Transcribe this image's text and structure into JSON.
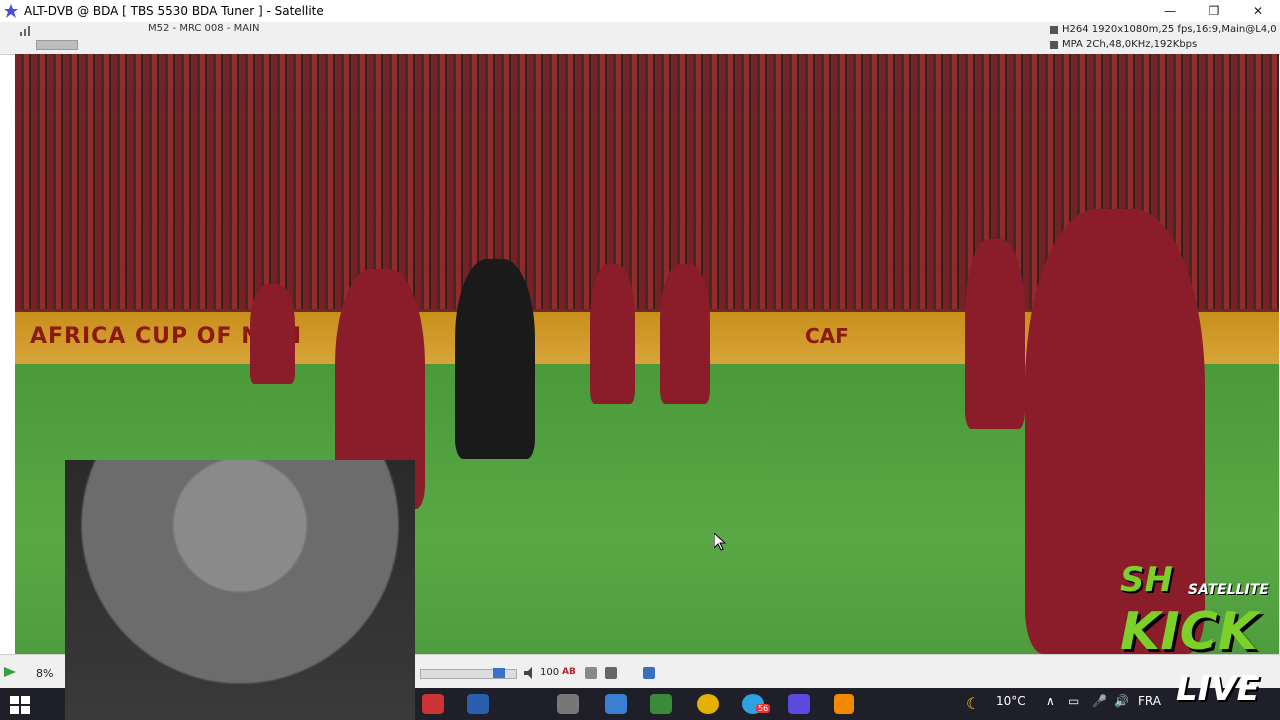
{
  "window": {
    "title": "ALT-DVB @ BDA [ TBS 5530 BDA Tuner ] - Satellite",
    "controls": {
      "minimize": "—",
      "restore": "❐",
      "close": "✕"
    }
  },
  "info_bar": {
    "channel": "M52 - MRC 008 - MAIN",
    "video_format": "H264 1920x1080m,25 fps,16:9,Main@L4,0",
    "audio_format": "MPA 2Ch,48,0KHz,192Kbps"
  },
  "video": {
    "banner_left": "AFRICA CUP OF NATI",
    "banner_right": "CAF"
  },
  "status_bar": {
    "signal_percent": "8%",
    "volume_value": "100",
    "ab_label": "AB",
    "volume_level": 0.82
  },
  "taskbar": {
    "temperature": "10°C",
    "language": "FRA",
    "telegram_badge": "56"
  },
  "overlay": {
    "logo_sh": "SH",
    "logo_satellite": "SATELLITE",
    "logo_kick": "KICK",
    "logo_live": "LIVE"
  },
  "colors": {
    "accent_green": "#7cd02a",
    "kit_red": "#8b1d2a",
    "banner_gold": "#d8a43a"
  }
}
